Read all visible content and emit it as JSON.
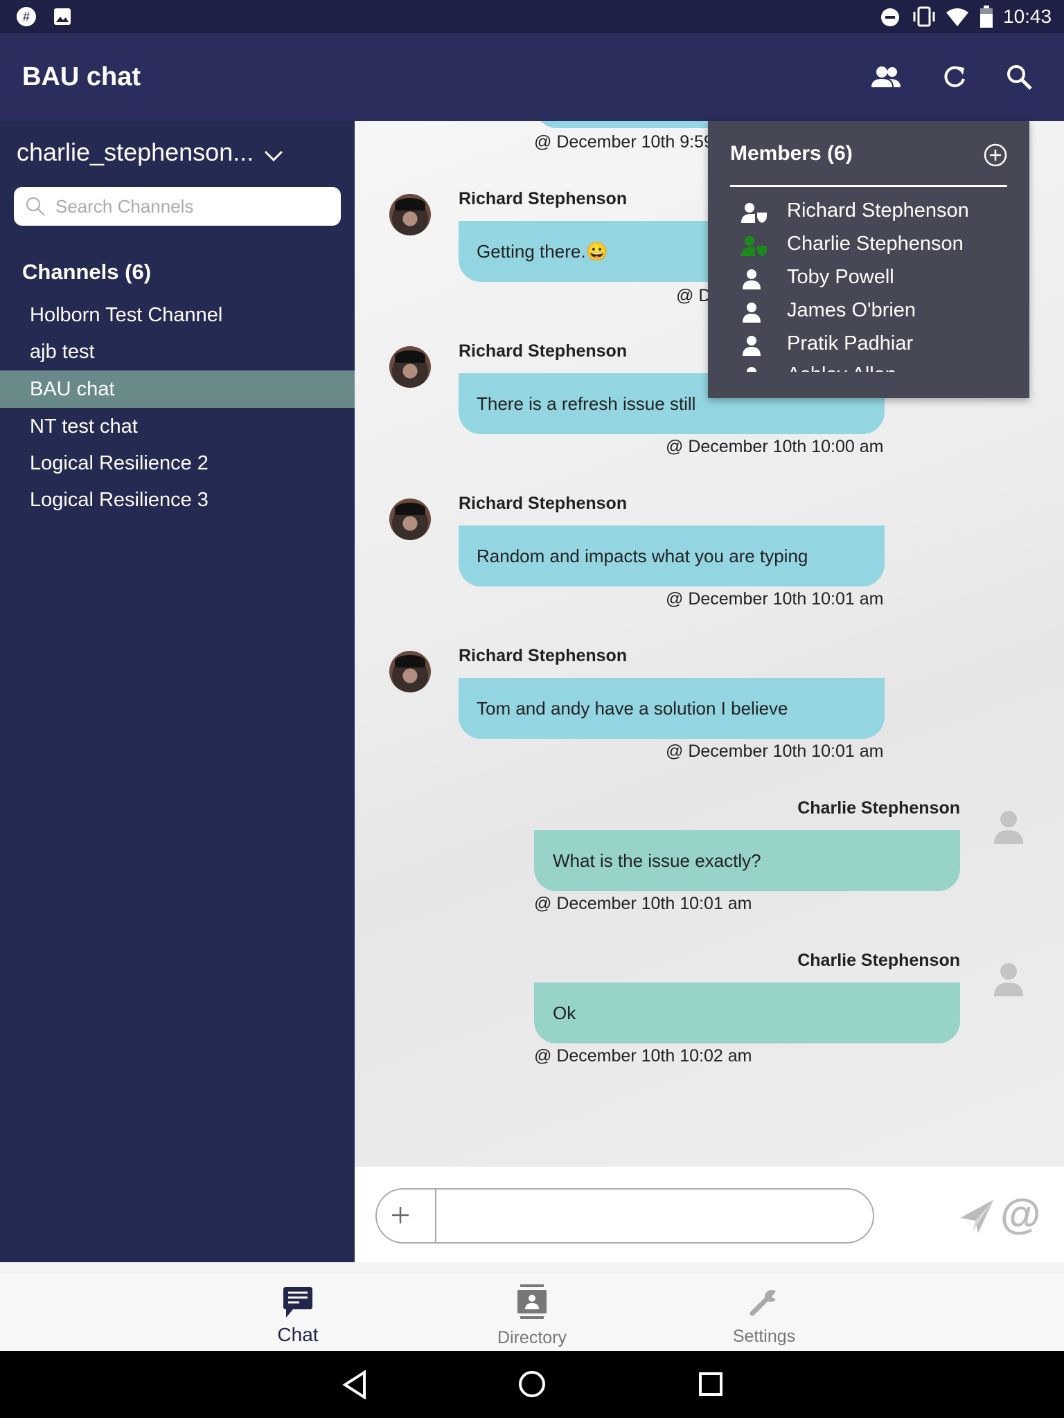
{
  "status_bar": {
    "time": "10:43",
    "icons": [
      "slack-icon",
      "image-icon",
      "do-not-disturb-icon",
      "vibrate-icon",
      "wifi-icon",
      "battery-icon"
    ]
  },
  "app_bar": {
    "title": "BAU chat",
    "icons": [
      "members-icon",
      "refresh-icon",
      "search-icon"
    ]
  },
  "sidebar": {
    "user": "charlie_stephenson...",
    "search_placeholder": "Search Channels",
    "channels_header": "Channels (6)",
    "channels": [
      {
        "label": "Holborn Test Channel"
      },
      {
        "label": "ajb test"
      },
      {
        "label": "BAU chat",
        "active": true
      },
      {
        "label": "NT test chat"
      },
      {
        "label": "Logical Resilience 2"
      },
      {
        "label": "Logical Resilience 3"
      }
    ]
  },
  "chat": {
    "partial_timestamp": "@ December 10th 9:59",
    "messages": [
      {
        "sender": "Richard Stephenson",
        "text": "Getting there.😀",
        "timestamp": "@ D",
        "side": "left"
      },
      {
        "sender": "Richard Stephenson",
        "text": "There is a refresh issue still",
        "timestamp": "@ December 10th 10:00 am",
        "side": "left"
      },
      {
        "sender": "Richard Stephenson",
        "text": "Random and impacts what you are typing",
        "timestamp": "@ December 10th 10:01 am",
        "side": "left"
      },
      {
        "sender": "Richard Stephenson",
        "text": "Tom and andy have a solution I believe",
        "timestamp": "@ December 10th 10:01 am",
        "side": "left"
      },
      {
        "sender": "Charlie Stephenson",
        "text": "What is the issue exactly?",
        "timestamp": "@ December 10th 10:01 am",
        "side": "right"
      },
      {
        "sender": "Charlie Stephenson",
        "text": "Ok",
        "timestamp": "@ December 10th 10:02 am",
        "side": "right"
      }
    ],
    "input_value": "",
    "colors": {
      "incoming": "#93d6e2",
      "outgoing": "#97d3c8"
    }
  },
  "members_panel": {
    "title": "Members (6)",
    "members": [
      {
        "name": "Richard Stephenson",
        "role": "admin"
      },
      {
        "name": "Charlie Stephenson",
        "role": "admin-self",
        "color": "#1a8a1a"
      },
      {
        "name": "Toby Powell"
      },
      {
        "name": "James O'brien"
      },
      {
        "name": "Pratik Padhiar"
      },
      {
        "name": "Ashley Allan"
      }
    ]
  },
  "bottom_nav": {
    "items": [
      {
        "label": "Chat",
        "active": true
      },
      {
        "label": "Directory"
      },
      {
        "label": "Settings"
      }
    ]
  }
}
